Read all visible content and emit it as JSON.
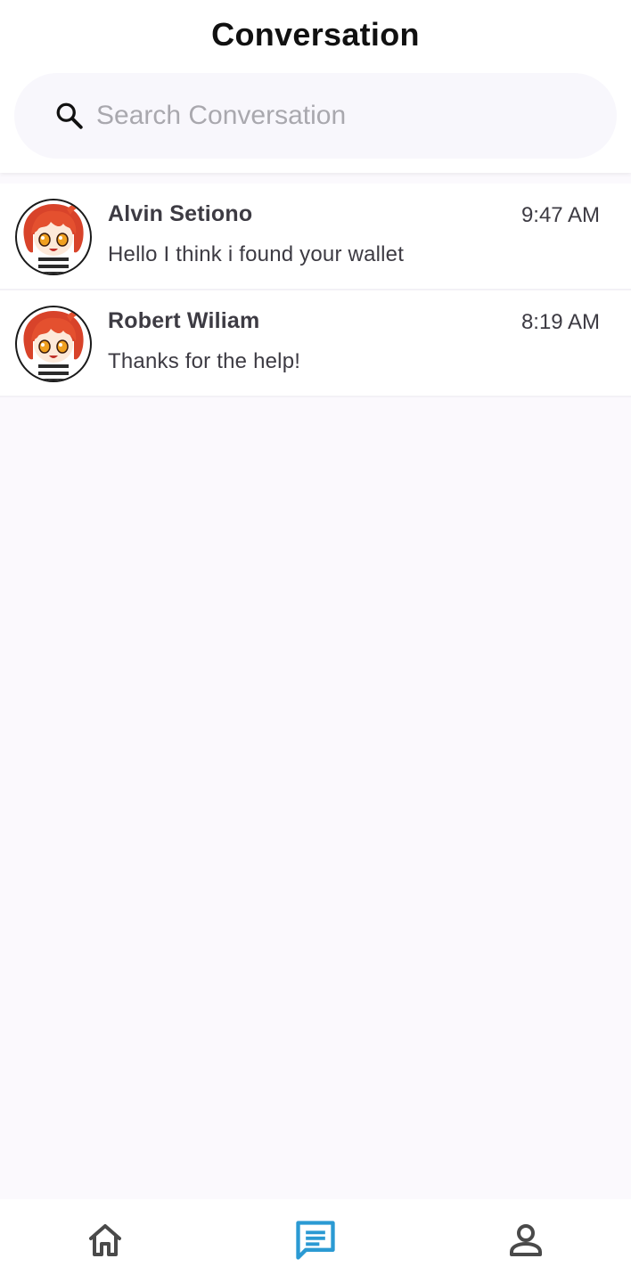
{
  "header": {
    "title": "Conversation"
  },
  "search": {
    "placeholder": "Search Conversation",
    "value": "",
    "icon": "search-icon"
  },
  "conversations": [
    {
      "name": "Alvin Setiono",
      "message": "Hello I think i found your wallet",
      "time": "9:47 AM",
      "avatar": "anime-avatar-icon"
    },
    {
      "name": "Robert Wiliam",
      "message": "Thanks for the help!",
      "time": "8:19 AM",
      "avatar": "anime-avatar-icon"
    }
  ],
  "bottom_nav": {
    "items": [
      {
        "icon": "home-icon",
        "active": false
      },
      {
        "icon": "chat-icon",
        "active": true
      },
      {
        "icon": "person-icon",
        "active": false
      }
    ],
    "active_color": "#2b9ad3",
    "inactive_color": "#4a4a4a"
  },
  "colors": {
    "background": "#fbf9fd",
    "text": "#3d3b43",
    "accent": "#2b9ad3"
  }
}
